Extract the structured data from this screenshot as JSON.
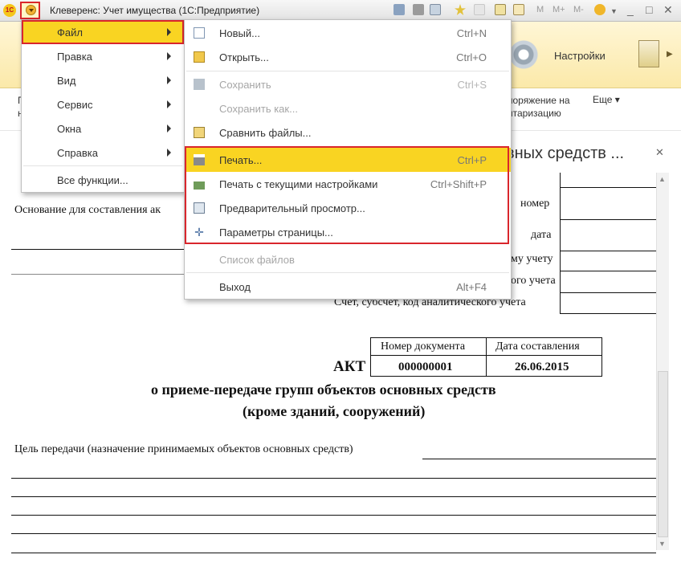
{
  "window": {
    "title": "Клеверенс: Учет имущества  (1С:Предприятие)",
    "logo_text": "1С",
    "m_buttons": [
      "M",
      "M+",
      "M-"
    ]
  },
  "command_bar": {
    "settings_label": "Настройки",
    "sub_left_1": "П",
    "sub_left_2": "н",
    "sub_link": "поряжение на\nнтаризацию",
    "more_label": "Еще ▾"
  },
  "document": {
    "tab_title": "вных средств ...",
    "basis_label": "Основание для составления ак",
    "right_labels": [
      "номер",
      "дата",
      "му учету",
      "ого учета",
      "Счет, субсчет, код аналитического учета"
    ],
    "table_headers": [
      "Номер документа",
      "Дата составления"
    ],
    "akt_word": "АКТ",
    "doc_number": "000000001",
    "doc_date": "26.06.2015",
    "heading_1": "о приеме-передаче групп объектов основных средств",
    "heading_2": "(кроме зданий, сооружений)",
    "purpose_label": "Цель передачи (назначение принимаемых объектов основных средств)"
  },
  "main_menu": {
    "items": [
      {
        "label": "Файл"
      },
      {
        "label": "Правка"
      },
      {
        "label": "Вид"
      },
      {
        "label": "Сервис"
      },
      {
        "label": "Окна"
      },
      {
        "label": "Справка"
      }
    ],
    "all_functions": "Все функции..."
  },
  "file_menu": {
    "new": {
      "label": "Новый...",
      "shortcut": "Ctrl+N"
    },
    "open": {
      "label": "Открыть...",
      "shortcut": "Ctrl+O"
    },
    "save": {
      "label": "Сохранить",
      "shortcut": "Ctrl+S"
    },
    "save_as": {
      "label": "Сохранить как..."
    },
    "compare": {
      "label": "Сравнить файлы..."
    },
    "print": {
      "label": "Печать...",
      "shortcut": "Ctrl+P"
    },
    "print_current": {
      "label": "Печать с текущими настройками",
      "shortcut": "Ctrl+Shift+P"
    },
    "preview": {
      "label": "Предварительный просмотр..."
    },
    "page_setup": {
      "label": "Параметры страницы..."
    },
    "file_list": {
      "label": "Список файлов"
    },
    "exit": {
      "label": "Выход",
      "shortcut": "Alt+F4"
    }
  },
  "colors": {
    "highlight": "#f9d422",
    "annotation_red": "#d9262c",
    "command_bar": "#fbe9a9"
  }
}
